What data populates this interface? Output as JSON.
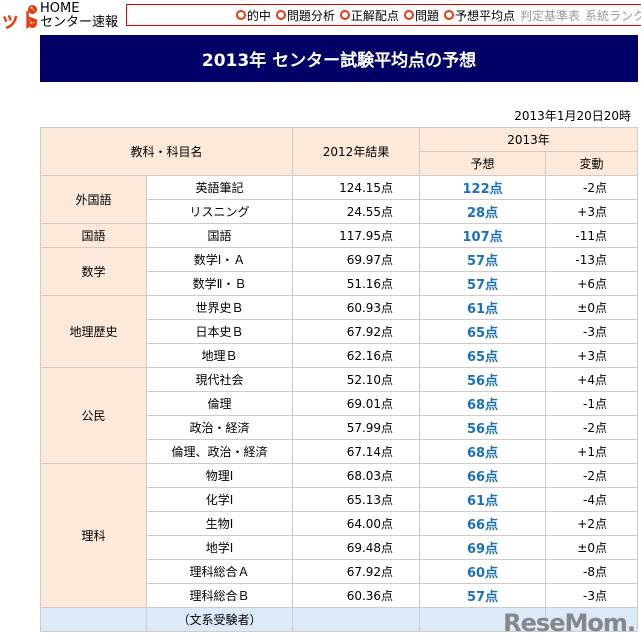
{
  "header": {
    "logo_fragment": "ット",
    "home": "HOME",
    "center": "センター速報"
  },
  "nav": {
    "items": [
      {
        "label": "的中",
        "active": true
      },
      {
        "label": "問題分析",
        "active": true
      },
      {
        "label": "正解配点",
        "active": true
      },
      {
        "label": "問題",
        "active": true
      },
      {
        "label": "予想平均点",
        "active": true
      },
      {
        "label": "判定基準表",
        "active": false
      },
      {
        "label": "系統ランク",
        "active": false
      }
    ]
  },
  "title": "2013年 センター試験平均点の予想",
  "date": "2013年1月20日20時",
  "table": {
    "headers": {
      "subject": "教科・科目名",
      "prev": "2012年結果",
      "year": "2013年",
      "forecast": "予想",
      "change": "変動"
    },
    "groups": [
      {
        "category": "外国語",
        "rows": [
          [
            "英語筆記",
            "124.15点",
            "122点",
            "-2点"
          ],
          [
            "リスニング",
            "24.55点",
            "28点",
            "+3点"
          ]
        ]
      },
      {
        "category": "国語",
        "rows": [
          [
            "国語",
            "117.95点",
            "107点",
            "-11点"
          ]
        ]
      },
      {
        "category": "数学",
        "rows": [
          [
            "数学Ⅰ・Ａ",
            "69.97点",
            "57点",
            "-13点"
          ],
          [
            "数学Ⅱ・Ｂ",
            "51.16点",
            "57点",
            "+6点"
          ]
        ]
      },
      {
        "category": "地理歴史",
        "rows": [
          [
            "世界史Ｂ",
            "60.93点",
            "61点",
            "±0点"
          ],
          [
            "日本史Ｂ",
            "67.92点",
            "65点",
            "-3点"
          ],
          [
            "地理Ｂ",
            "62.16点",
            "65点",
            "+3点"
          ]
        ]
      },
      {
        "category": "公民",
        "rows": [
          [
            "現代社会",
            "52.10点",
            "56点",
            "+4点"
          ],
          [
            "倫理",
            "69.01点",
            "68点",
            "-1点"
          ],
          [
            "政治・経済",
            "57.99点",
            "56点",
            "-2点"
          ],
          [
            "倫理、政治・経済",
            "67.14点",
            "68点",
            "+1点"
          ]
        ]
      },
      {
        "category": "理科",
        "rows": [
          [
            "物理Ⅰ",
            "68.03点",
            "66点",
            "-2点"
          ],
          [
            "化学Ⅰ",
            "65.13点",
            "61点",
            "-4点"
          ],
          [
            "生物Ⅰ",
            "64.00点",
            "66点",
            "+2点"
          ],
          [
            "地学Ⅰ",
            "69.48点",
            "69点",
            "±0点"
          ],
          [
            "理科総合Ａ",
            "67.92点",
            "60点",
            "-8点"
          ],
          [
            "理科総合Ｂ",
            "60.36点",
            "57点",
            "-3点"
          ]
        ]
      }
    ],
    "partial_row": "（文系受験者）"
  },
  "watermark": "ReseMom"
}
